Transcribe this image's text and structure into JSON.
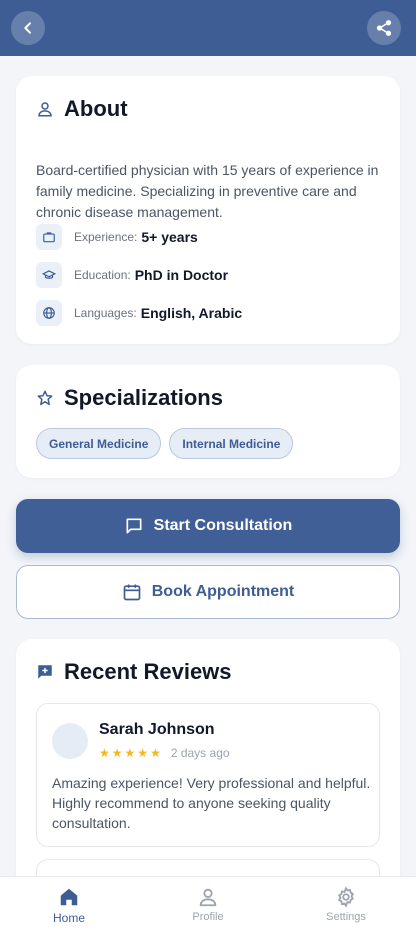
{
  "about": {
    "title": "About",
    "description": "Board-certified physician with 15 years of experience in family medicine. Specializing in preventive care and chronic disease management.",
    "info": [
      {
        "label": "Experience:",
        "value": "5+ years",
        "icon": "briefcase-icon"
      },
      {
        "label": "Education:",
        "value": "PhD in Doctor",
        "icon": "graduation-cap-icon"
      },
      {
        "label": "Languages:",
        "value": "English, Arabic",
        "icon": "globe-icon"
      }
    ]
  },
  "specializations": {
    "title": "Specializations",
    "chips": [
      "General Medicine",
      "Internal Medicine"
    ]
  },
  "actions": {
    "start_consultation": "Start Consultation",
    "book_appointment": "Book Appointment"
  },
  "reviews": {
    "title": "Recent Reviews",
    "items": [
      {
        "name": "Sarah Johnson",
        "rating": 5,
        "date": "2 days ago",
        "text": "Amazing experience! Very professional and helpful. Highly recommend to anyone seeking quality consultation."
      }
    ]
  },
  "nav": {
    "home": "Home",
    "profile": "Profile",
    "settings": "Settings"
  },
  "colors": {
    "primary": "#3d5d94",
    "star": "#f5b81b",
    "background": "#f3f5f9"
  }
}
